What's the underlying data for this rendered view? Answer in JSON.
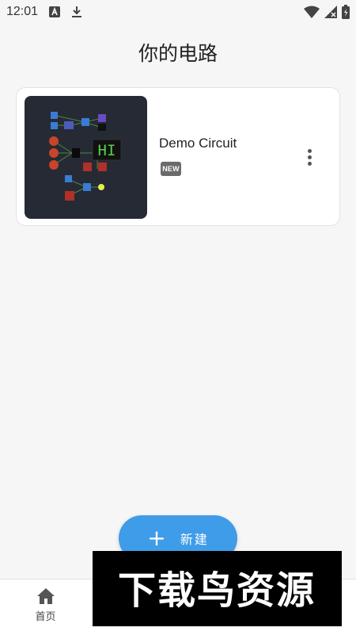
{
  "status_bar": {
    "time": "12:01"
  },
  "header": {
    "title": "你的电路"
  },
  "circuits": [
    {
      "name": "Demo Circuit",
      "badge": "NEW",
      "thumbnail_text": "HI"
    }
  ],
  "fab": {
    "label": "新建",
    "icon": "plus-icon"
  },
  "bottom_nav": {
    "items": [
      {
        "label": "首页",
        "icon": "home-icon"
      }
    ]
  },
  "watermark": {
    "text": "下载鸟资源"
  },
  "colors": {
    "accent": "#3f9ce8",
    "background": "#f6f6f7",
    "thumbnail_bg": "#252a35"
  }
}
